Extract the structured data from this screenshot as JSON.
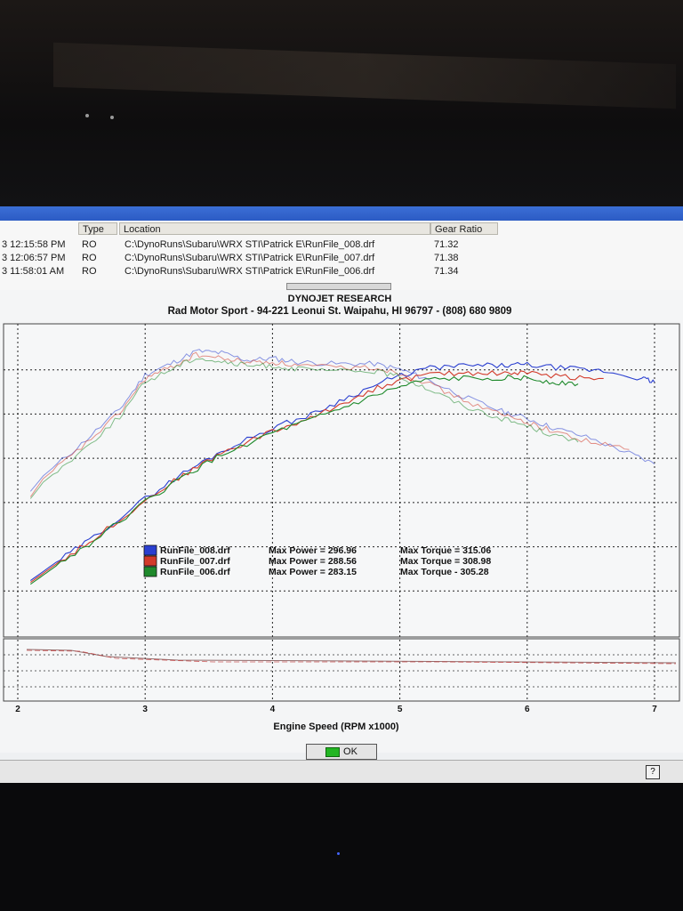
{
  "list": {
    "columns": {
      "type": "Type",
      "location": "Location",
      "gear_ratio": "Gear Ratio"
    },
    "rows": [
      {
        "time": "3 12:15:58 PM",
        "type": "RO",
        "location": "C:\\DynoRuns\\Subaru\\WRX STI\\Patrick E\\RunFile_008.drf",
        "gear": "71.32"
      },
      {
        "time": "3 12:06:57 PM",
        "type": "RO",
        "location": "C:\\DynoRuns\\Subaru\\WRX STI\\Patrick E\\RunFile_007.drf",
        "gear": "71.38"
      },
      {
        "time": "3 11:58:01 AM",
        "type": "RO",
        "location": "C:\\DynoRuns\\Subaru\\WRX STI\\Patrick E\\RunFile_006.drf",
        "gear": "71.34"
      }
    ]
  },
  "chart_data": {
    "type": "line",
    "title": "DYNOJET RESEARCH",
    "subtitle": "Rad Motor Sport - 94-221 Leonui St. Waipahu, HI 96797 - (808) 680 9809",
    "xlabel": "Engine Speed (RPM x1000)",
    "x_ticks": [
      "2",
      "3",
      "4",
      "5",
      "6",
      "7"
    ],
    "xlim": [
      2,
      7
    ],
    "ylim": [
      0,
      340
    ],
    "grid": true,
    "colors": {
      "008": "#2a3fd0",
      "007": "#d23a2a",
      "006": "#1f8a2c"
    },
    "legend": [
      {
        "file": "RunFile_008.drf",
        "power_label": "Max Power = 296.96",
        "torque_label": "Max Torque = 315.06",
        "color": "#2a3fd0"
      },
      {
        "file": "RunFile_007.drf",
        "power_label": "Max Power = 288.56",
        "torque_label": "Max Torque = 308.98",
        "color": "#d23a2a"
      },
      {
        "file": "RunFile_006.drf",
        "power_label": "Max Power = 283.15",
        "torque_label": "Max Torque - 305.28",
        "color": "#1f8a2c"
      }
    ],
    "series": [
      {
        "name": "RunFile_008.drf",
        "color": "#2a3fd0",
        "torque": {
          "x": [
            2.1,
            2.2,
            2.5,
            2.8,
            3.0,
            3.2,
            3.4,
            3.6,
            3.8,
            4.0,
            4.2,
            4.5,
            4.8,
            5.0,
            5.2,
            5.5,
            5.8,
            6.0,
            6.2,
            6.5,
            6.8,
            7.0
          ],
          "y": [
            158,
            175,
            210,
            248,
            286,
            298,
            312,
            310,
            302,
            304,
            300,
            298,
            298,
            292,
            282,
            262,
            246,
            238,
            228,
            216,
            200,
            188
          ]
        },
        "power": {
          "x": [
            2.1,
            2.3,
            2.6,
            3.0,
            3.3,
            3.6,
            4.0,
            4.3,
            4.6,
            4.9,
            5.2,
            5.5,
            5.8,
            6.0,
            6.3,
            6.6,
            6.9,
            7.0
          ],
          "y": [
            60,
            80,
            108,
            150,
            178,
            202,
            228,
            242,
            262,
            280,
            293,
            296,
            296,
            297,
            293,
            290,
            282,
            278
          ]
        }
      },
      {
        "name": "RunFile_007.drf",
        "color": "#d23a2a",
        "torque": {
          "x": [
            2.1,
            2.2,
            2.5,
            2.8,
            3.0,
            3.2,
            3.4,
            3.6,
            3.8,
            4.0,
            4.2,
            4.5,
            4.8,
            5.0,
            5.2,
            5.5,
            5.8,
            6.0,
            6.2,
            6.5,
            6.8
          ],
          "y": [
            152,
            172,
            206,
            244,
            282,
            294,
            308,
            304,
            300,
            300,
            296,
            294,
            294,
            288,
            278,
            258,
            242,
            234,
            224,
            212,
            204
          ]
        },
        "power": {
          "x": [
            2.1,
            2.3,
            2.6,
            3.0,
            3.3,
            3.6,
            4.0,
            4.3,
            4.6,
            4.9,
            5.2,
            5.5,
            5.8,
            6.0,
            6.3,
            6.6
          ],
          "y": [
            58,
            78,
            106,
            148,
            176,
            200,
            224,
            238,
            258,
            276,
            286,
            288,
            288,
            288,
            284,
            282
          ]
        }
      },
      {
        "name": "RunFile_006.drf",
        "color": "#1f8a2c",
        "torque": {
          "x": [
            2.1,
            2.2,
            2.5,
            2.8,
            3.0,
            3.2,
            3.4,
            3.6,
            3.8,
            4.0,
            4.2,
            4.5,
            4.8,
            5.0,
            5.2,
            5.5,
            5.8,
            6.0,
            6.2,
            6.4
          ],
          "y": [
            150,
            168,
            202,
            240,
            278,
            292,
            305,
            300,
            296,
            296,
            292,
            290,
            290,
            284,
            272,
            252,
            238,
            230,
            220,
            212
          ]
        },
        "power": {
          "x": [
            2.1,
            2.3,
            2.6,
            3.0,
            3.3,
            3.6,
            4.0,
            4.3,
            4.6,
            4.9,
            5.2,
            5.5,
            5.8,
            6.0,
            6.2,
            6.4
          ],
          "y": [
            56,
            76,
            104,
            146,
            174,
            198,
            222,
            236,
            252,
            268,
            280,
            282,
            283,
            282,
            278,
            276
          ]
        }
      }
    ]
  },
  "buttons": {
    "ok": "OK",
    "help": "?"
  }
}
